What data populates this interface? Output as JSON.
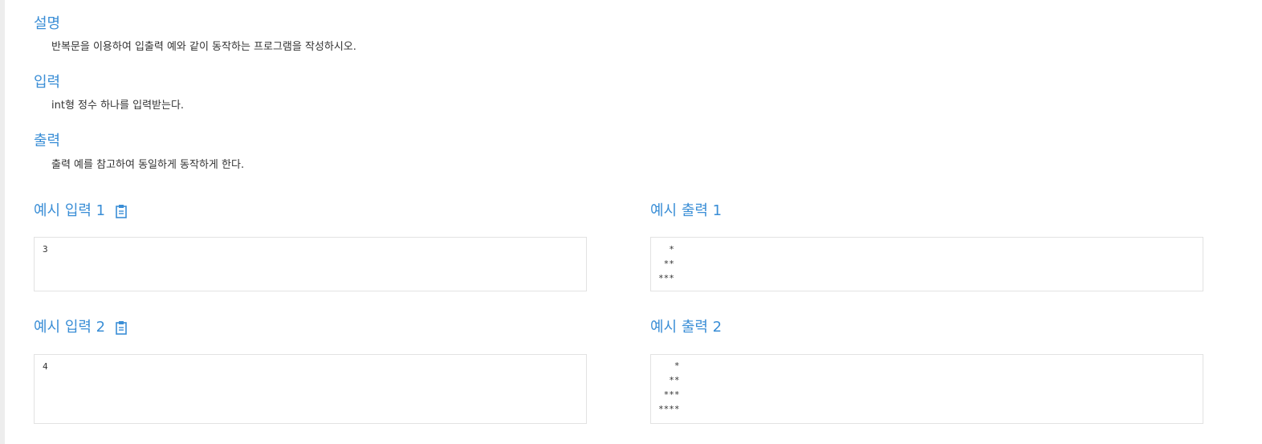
{
  "description": {
    "title": "설명",
    "text": "반복문을 이용하여 입출력 예와 같이 동작하는 프로그램을 작성하시오."
  },
  "input": {
    "title": "입력",
    "text": "int형 정수 하나를 입력받는다."
  },
  "output": {
    "title": "출력",
    "text": "출력 예를 참고하여 동일하게 동작하게 한다."
  },
  "samples": [
    {
      "input_title": "예시 입력 1",
      "input_value": "3",
      "output_title": "예시 출력 1",
      "output_value": "  *\n **\n***"
    },
    {
      "input_title": "예시 입력 2",
      "input_value": "4",
      "output_title": "예시 출력 2",
      "output_value": "   *\n  **\n ***\n****"
    }
  ],
  "icons": {
    "copy": "clipboard-icon"
  },
  "colors": {
    "accent": "#3a8ed6",
    "text": "#333333",
    "border": "#e2e2e2"
  }
}
